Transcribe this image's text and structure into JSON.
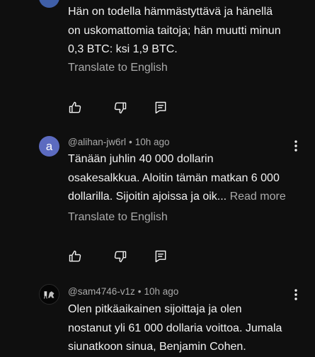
{
  "comments": [
    {
      "avatar_icon": "avatar-icon",
      "body_lines": [
        "Hän on todella hämmästyttävä ja hänellä",
        "on uskomattomia taitoja; hän muutti minun",
        "0,3 BTC: ksi 1,9 BTC."
      ],
      "translate_label": "Translate to English",
      "actions": {
        "like_icon": "thumbs-up-icon",
        "dislike_icon": "thumbs-down-icon",
        "reply_icon": "reply-icon"
      }
    },
    {
      "avatar_letter": "a",
      "author": "@alihan-jw6rl",
      "separator": "•",
      "time": "10h ago",
      "body_lines": [
        "Tänään juhlin 40 000 dollarin",
        "osakesalkkua. Aloitin tämän matkan 6 000",
        "dollarilla. Sijoitin ajoissa ja oik..."
      ],
      "read_more": "Read more",
      "translate_label": "Translate to English",
      "actions": {
        "like_icon": "thumbs-up-icon",
        "dislike_icon": "thumbs-down-icon",
        "reply_icon": "reply-icon"
      },
      "more_icon": "more-vertical-icon"
    },
    {
      "avatar_icon": "avatar-icon",
      "author": "@sam4746-v1z",
      "separator": "•",
      "time": "10h ago",
      "body_lines": [
        "Olen pitkäaikainen sijoittaja ja olen",
        "nostanut yli 61 000 dollaria voittoa. Jumala",
        "siunatkoon sinua, Benjamin Cohen."
      ],
      "more_icon": "more-vertical-icon"
    }
  ],
  "colors": {
    "background": "#0f0f0f",
    "primary_text": "#f1f1f1",
    "secondary_text": "#aaaaaa",
    "avatar_a": "#5c6bc0"
  }
}
